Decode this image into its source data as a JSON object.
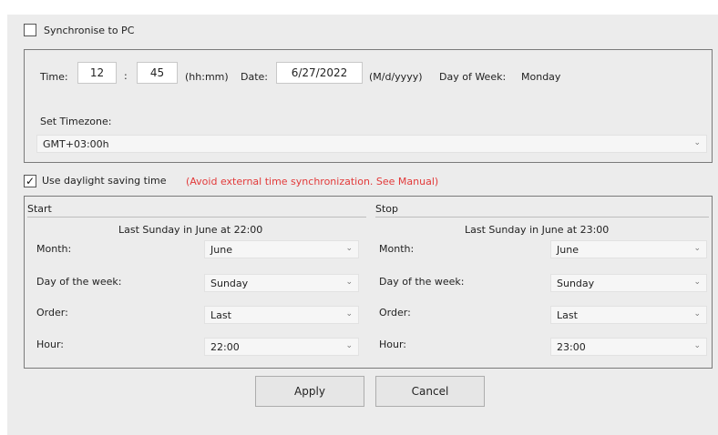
{
  "sync": {
    "label": "Synchronise to PC",
    "checked": false
  },
  "datetime": {
    "time_label": "Time:",
    "hour": "12",
    "separator": ":",
    "minute": "45",
    "time_format": "(hh:mm)",
    "date_label": "Date:",
    "date": "6/27/2022",
    "date_format": "(M/d/yyyy)",
    "dow_label": "Day of Week:",
    "dow_value": "Monday",
    "timezone_label": "Set Timezone:",
    "timezone_value": "GMT+03:00h"
  },
  "dst": {
    "label": "Use daylight saving time",
    "checked": true,
    "warning": "(Avoid external time synchronization. See Manual)"
  },
  "start": {
    "title": "Start",
    "summary": "Last Sunday in June at 22:00",
    "month_label": "Month:",
    "month": "June",
    "dow_label": "Day of the week:",
    "dow": "Sunday",
    "order_label": "Order:",
    "order": "Last",
    "hour_label": "Hour:",
    "hour": "22:00"
  },
  "stop": {
    "title": "Stop",
    "summary": "Last Sunday in June at 23:00",
    "month_label": "Month:",
    "month": "June",
    "dow_label": "Day of the week:",
    "dow": "Sunday",
    "order_label": "Order:",
    "order": "Last",
    "hour_label": "Hour:",
    "hour": "23:00"
  },
  "buttons": {
    "apply": "Apply",
    "cancel": "Cancel"
  },
  "icons": {
    "chevron": "chevron-down-icon",
    "check": "checkmark-icon"
  }
}
